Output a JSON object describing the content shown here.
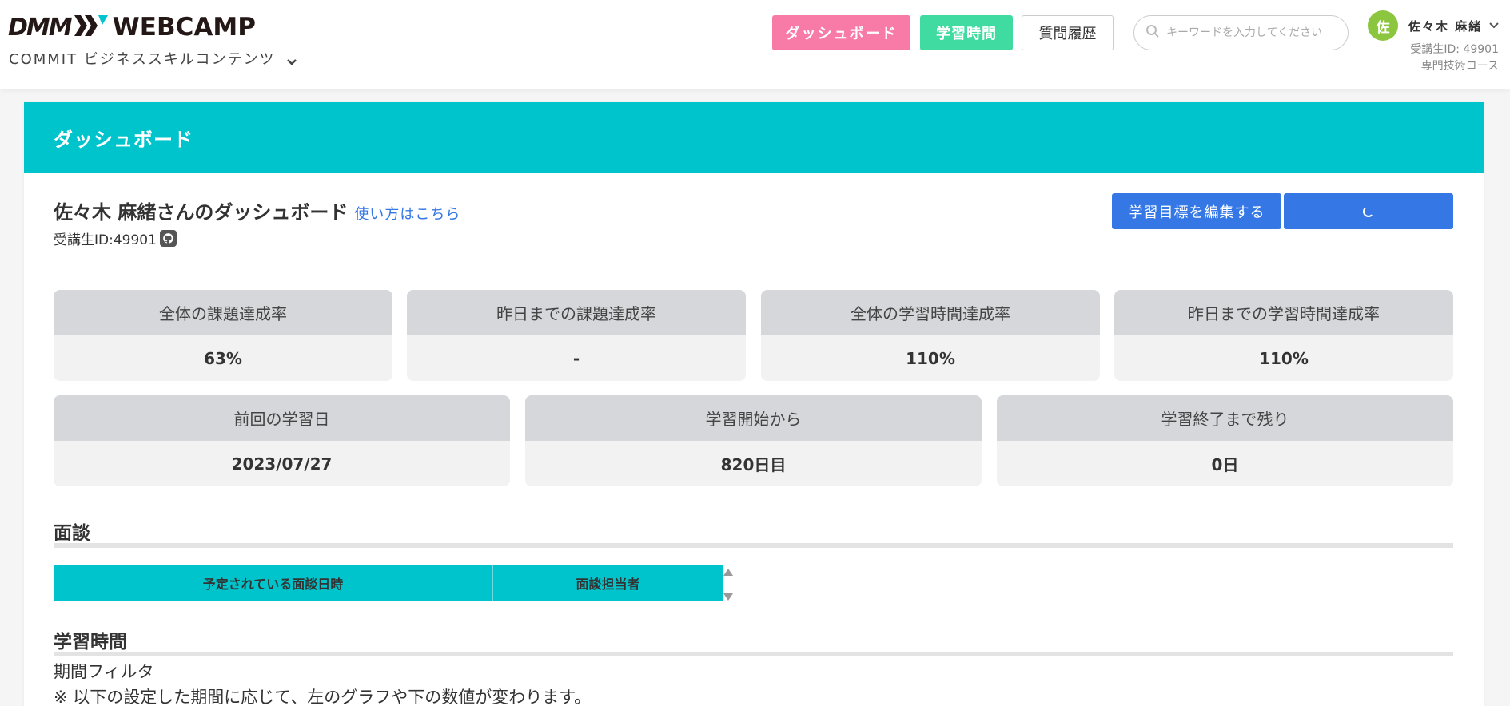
{
  "header": {
    "logo_dmm": "DMM",
    "logo_webcamp": "WEBCAMP",
    "course_select": "COMMIT ビジネススキルコンテンツ",
    "buttons": {
      "dashboard": "ダッシュボード",
      "study_time": "学習時間",
      "question_history": "質問履歴"
    },
    "search": {
      "placeholder": "キーワードを入力してください"
    },
    "user": {
      "avatar_initial": "佐",
      "name": "佐々木 麻緒",
      "student_id": "受講生ID: 49901",
      "course": "専門技術コース"
    }
  },
  "card": {
    "heading": "ダッシュボード",
    "dashboard_title": "佐々木 麻緒さんのダッシュボード",
    "howto_link": "使い方はこちら",
    "student_id": "受講生ID:49901",
    "edit_goal_button": "学習目標を編集する"
  },
  "stats_row1": [
    {
      "label": "全体の課題達成率",
      "value": "63%"
    },
    {
      "label": "昨日までの課題達成率",
      "value": "-"
    },
    {
      "label": "全体の学習時間達成率",
      "value": "110%"
    },
    {
      "label": "昨日までの学習時間達成率",
      "value": "110%"
    }
  ],
  "stats_row2": [
    {
      "label": "前回の学習日",
      "value": "2023/07/27"
    },
    {
      "label": "学習開始から",
      "value": "820日目"
    },
    {
      "label": "学習終了まで残り",
      "value": "0日"
    }
  ],
  "interview": {
    "title": "面談",
    "columns": [
      "予定されている面談日時",
      "面談担当者"
    ]
  },
  "study_time": {
    "title": "学習時間",
    "filter_label": "期間フィルタ",
    "note": "※ 以下の設定した期間に応じて、左のグラフや下の数値が変わります。"
  },
  "colors": {
    "teal": "#00c4cc",
    "pink": "#f77ba6",
    "green": "#40dba0",
    "blue": "#3578e5",
    "avatar": "#8cc63f"
  },
  "icons": [
    "webcamp-logo-icon",
    "chevron-down-icon",
    "search-icon",
    "github-icon",
    "loading-spinner-icon",
    "sort-up-icon",
    "sort-down-icon"
  ]
}
